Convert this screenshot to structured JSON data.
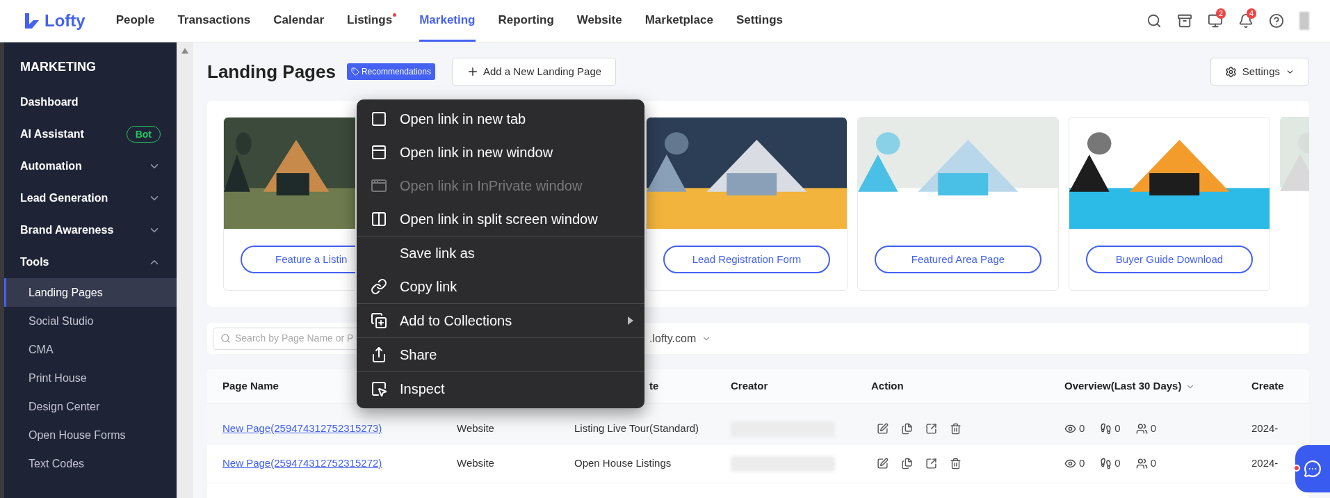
{
  "header": {
    "logo": "Lofty",
    "nav": [
      {
        "label": "People",
        "selected": false,
        "dot": false
      },
      {
        "label": "Transactions",
        "selected": false,
        "dot": false
      },
      {
        "label": "Calendar",
        "selected": false,
        "dot": false
      },
      {
        "label": "Listings",
        "selected": false,
        "dot": true
      },
      {
        "label": "Marketing",
        "selected": true,
        "dot": false
      },
      {
        "label": "Reporting",
        "selected": false,
        "dot": false
      },
      {
        "label": "Website",
        "selected": false,
        "dot": false
      },
      {
        "label": "Marketplace",
        "selected": false,
        "dot": false
      },
      {
        "label": "Settings",
        "selected": false,
        "dot": false
      }
    ],
    "icons": [
      {
        "kind": "search"
      },
      {
        "kind": "inbox"
      },
      {
        "kind": "sales",
        "badge": "2"
      },
      {
        "kind": "bell",
        "badge": "4"
      },
      {
        "kind": "help"
      }
    ]
  },
  "sidebar": {
    "heading": "MARKETING",
    "items": [
      {
        "kind": "link",
        "label": "Dashboard"
      },
      {
        "kind": "link",
        "label": "AI Assistant",
        "badge": "Bot"
      },
      {
        "kind": "group",
        "label": "Automation",
        "expanded": false
      },
      {
        "kind": "group",
        "label": "Lead Generation",
        "expanded": false
      },
      {
        "kind": "group",
        "label": "Brand Awareness",
        "expanded": false
      },
      {
        "kind": "group",
        "label": "Tools",
        "expanded": true,
        "children": [
          {
            "label": "Landing Pages",
            "selected": true
          },
          {
            "label": "Social Studio",
            "selected": false
          },
          {
            "label": "CMA",
            "selected": false
          },
          {
            "label": "Print House",
            "selected": false
          },
          {
            "label": "Design Center",
            "selected": false
          },
          {
            "label": "Open House Forms",
            "selected": false
          },
          {
            "label": "Text Codes",
            "selected": false
          }
        ]
      }
    ]
  },
  "page": {
    "title": "Landing Pages",
    "badge": "Recommendations",
    "add_button": "Add a New Landing Page",
    "settings_button": "Settings"
  },
  "templates": [
    {
      "button": "Feature a Listin"
    },
    {
      "button": "Lead Registration Form"
    },
    {
      "button": "Featured Area Page"
    },
    {
      "button": "Buyer Guide Download"
    },
    {
      "kind": "picture"
    }
  ],
  "search": {
    "placeholder": "Search by Page Name or P"
  },
  "domain_filter": {
    "value": ".lofty.com"
  },
  "table": {
    "columns": {
      "page_name": "Page Name",
      "column_3": "te",
      "creator": "Creator",
      "action": "Action",
      "overview": "Overview(Last 30 Days)",
      "column_7": "Create"
    },
    "rows": [
      {
        "page_name": "New Page(259474312752315273)",
        "column_2": "Website",
        "column_3": "Listing Live Tour(Standard)",
        "views": "0",
        "visits": "0",
        "leads": "0",
        "column_7": "2024-"
      },
      {
        "page_name": "New Page(259474312752315272)",
        "column_2": "Website",
        "column_3": "Open House Listings",
        "views": "0",
        "visits": "0",
        "leads": "0",
        "column_7": "2024-"
      }
    ]
  },
  "context_menu": {
    "groups": [
      [
        {
          "label": "Open link in new tab",
          "disabled": false,
          "submenu": false
        },
        {
          "label": "Open link in new window",
          "disabled": false,
          "submenu": false
        },
        {
          "label": "Open link in InPrivate window",
          "disabled": true,
          "submenu": false
        },
        {
          "label": "Open link in split screen window",
          "disabled": false,
          "submenu": false
        }
      ],
      [
        {
          "label": "Save link as",
          "disabled": false,
          "submenu": false
        },
        {
          "label": "Copy link",
          "disabled": false,
          "submenu": false
        }
      ],
      [
        {
          "label": "Add to Collections",
          "disabled": false,
          "submenu": true
        }
      ],
      [
        {
          "label": "Share",
          "disabled": false,
          "submenu": false
        }
      ],
      [
        {
          "label": "Inspect",
          "disabled": false,
          "submenu": false
        }
      ]
    ]
  }
}
